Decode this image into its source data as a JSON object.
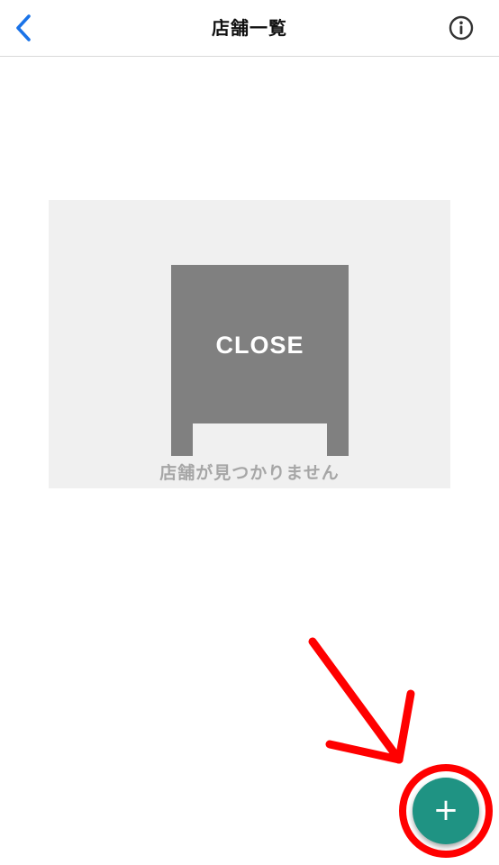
{
  "header": {
    "title": "店舗一覧",
    "back_icon": "chevron-left-icon",
    "info_icon": "info-circle-icon"
  },
  "empty_state": {
    "sign_text": "CLOSE",
    "message": "店舗が見つかりません",
    "icon": "closed-sign-icon"
  },
  "fab": {
    "label": "+",
    "color": "#1f9383"
  },
  "annotation": {
    "color": "#ff0000",
    "shape": "arrow-and-circle"
  },
  "colors": {
    "accent": "#1a73e8",
    "empty_bg": "#f0f0f0",
    "sign": "#808080",
    "muted_text": "#a6a6a6"
  }
}
